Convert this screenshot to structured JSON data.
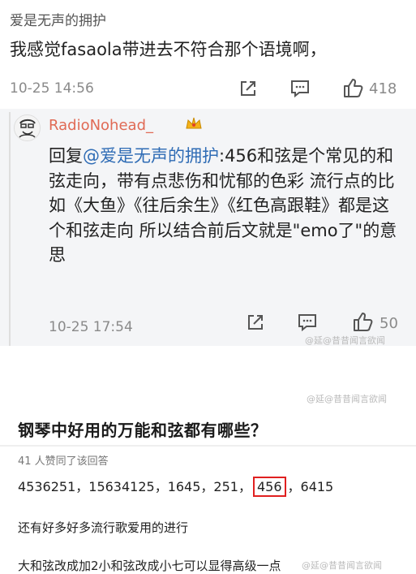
{
  "comment": {
    "username": "爱是无声的拥护",
    "text": "我感觉fasaola带进去不符合那个语境啊，",
    "time": "10-25 14:56",
    "likes": "418",
    "icons": [
      "share-icon",
      "comment-icon",
      "like-icon"
    ]
  },
  "reply": {
    "username": "RadioNohead_",
    "badge_icon": "crown-icon",
    "prefix": "回复",
    "mention": "@爱是无声的拥护",
    "body": ":456和弦是个常见的和弦走向，带有点悲伤和忧郁的色彩 流行点的比如《大鱼》《往后余生》《红色高跟鞋》都是这个和弦走向 所以结合前后文就是\"emo了\"的意思",
    "time": "10-25 17:54",
    "likes": "50"
  },
  "watermarks": [
    "@延@昔昔闻言欲闻",
    "@延@昔昔闻言欲闻",
    "@延@昔昔闻言欲闻"
  ],
  "answer": {
    "question": "钢琴中好用的万能和弦都有哪些？",
    "endorse": "41 人赞同了该回答",
    "chords_before": "4536251，15634125，1645，251，",
    "chords_highlight": "456",
    "chords_after": "，6415",
    "line2": "还有好多好多流行歌爱用的进行",
    "line3": "大和弦改成加2小和弦改成小七可以显得高级一点"
  },
  "colors": {
    "accent": "#e06a55",
    "mention": "#2f6cb5",
    "highlight_box": "#e02020"
  }
}
